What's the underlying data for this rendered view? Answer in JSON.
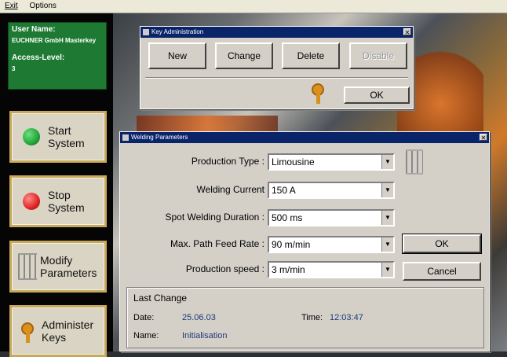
{
  "menu": {
    "items": [
      "Exit",
      "Options"
    ]
  },
  "user": {
    "name_label": "User Name:",
    "name_value": "EUCHNER GmbH Masterkey",
    "access_label": "Access-Level:",
    "access_value": "3"
  },
  "sidebar": {
    "start": {
      "line1": "Start",
      "line2": "System",
      "color": "#22a53a"
    },
    "stop": {
      "line1": "Stop",
      "line2": "System",
      "color": "#e02424"
    },
    "modify": {
      "line1": "Modify",
      "line2": "Parameters"
    },
    "administer": {
      "line1": "Administer",
      "line2": "Keys"
    }
  },
  "key_admin": {
    "title": "Key Administration",
    "buttons": {
      "new": "New",
      "change": "Change",
      "delete": "Delete",
      "disable": "Disable",
      "ok": "OK"
    }
  },
  "welding": {
    "title": "Welding Parameters",
    "fields": [
      {
        "label": "Production Type :",
        "value": "Limousine"
      },
      {
        "label": "Welding Current",
        "value": "150 A"
      },
      {
        "label": "Spot Welding Duration :",
        "value": "500 ms"
      },
      {
        "label": "Max. Path Feed Rate :",
        "value": "90 m/min"
      },
      {
        "label": "Production speed :",
        "value": "3 m/min"
      }
    ],
    "ok": "OK",
    "cancel": "Cancel",
    "last_change": {
      "title": "Last Change",
      "date_label": "Date:",
      "date_value": "25.06.03",
      "time_label": "Time:",
      "time_value": "12:03:47",
      "name_label": "Name:",
      "name_value": "Initialisation"
    }
  }
}
